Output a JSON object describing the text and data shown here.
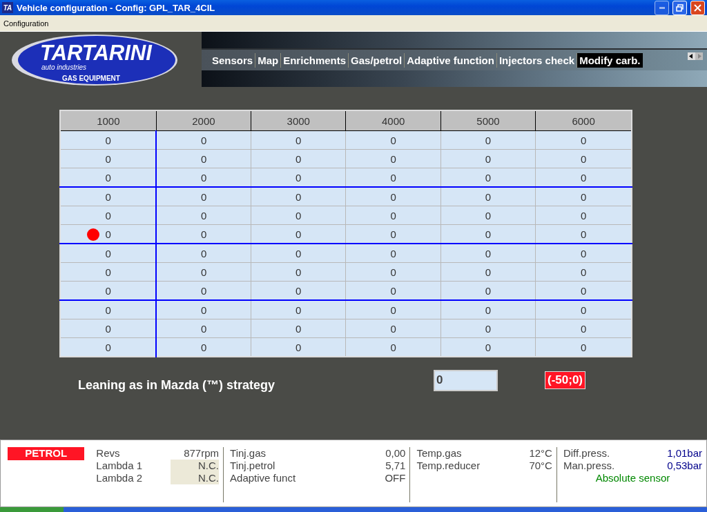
{
  "window": {
    "title": "Vehicle configuration - Config: GPL_TAR_4CIL",
    "icon_text": "TA"
  },
  "menu": [
    "Configuration"
  ],
  "logo": {
    "name": "TARTARINI",
    "subtitle": "auto industries",
    "tagline": "GAS EQUIPMENT"
  },
  "tabs": [
    {
      "label": "Sensors",
      "selected": false
    },
    {
      "label": "Map",
      "selected": false
    },
    {
      "label": "Enrichments",
      "selected": false
    },
    {
      "label": "Gas/petrol",
      "selected": false
    },
    {
      "label": "Adaptive function",
      "selected": false
    },
    {
      "label": "Injectors check",
      "selected": false
    },
    {
      "label": "Modify carb.",
      "selected": true
    }
  ],
  "table": {
    "columns": [
      "1000",
      "2000",
      "3000",
      "4000",
      "5000",
      "6000"
    ],
    "rows": [
      {
        "cells": [
          "0",
          "0",
          "0",
          "0",
          "0",
          "0"
        ],
        "marker": false
      },
      {
        "cells": [
          "0",
          "0",
          "0",
          "0",
          "0",
          "0"
        ],
        "marker": false
      },
      {
        "cells": [
          "0",
          "0",
          "0",
          "0",
          "0",
          "0"
        ],
        "marker": false
      },
      {
        "cells": [
          "0",
          "0",
          "0",
          "0",
          "0",
          "0"
        ],
        "marker": false
      },
      {
        "cells": [
          "0",
          "0",
          "0",
          "0",
          "0",
          "0"
        ],
        "marker": false
      },
      {
        "cells": [
          "0",
          "0",
          "0",
          "0",
          "0",
          "0"
        ],
        "marker": true
      },
      {
        "cells": [
          "0",
          "0",
          "0",
          "0",
          "0",
          "0"
        ],
        "marker": false
      },
      {
        "cells": [
          "0",
          "0",
          "0",
          "0",
          "0",
          "0"
        ],
        "marker": false
      },
      {
        "cells": [
          "0",
          "0",
          "0",
          "0",
          "0",
          "0"
        ],
        "marker": false
      },
      {
        "cells": [
          "0",
          "0",
          "0",
          "0",
          "0",
          "0"
        ],
        "marker": false
      },
      {
        "cells": [
          "0",
          "0",
          "0",
          "0",
          "0",
          "0"
        ],
        "marker": false
      },
      {
        "cells": [
          "0",
          "0",
          "0",
          "0",
          "0",
          "0"
        ],
        "marker": false
      }
    ]
  },
  "leaning": {
    "label": "Leaning as in Mazda (™) strategy",
    "value": "0",
    "range": "(-50;0)"
  },
  "status_bar": {
    "mode": "PETROL",
    "groups": [
      [
        {
          "label": "Revs",
          "value": "877rpm",
          "shaded": false
        },
        {
          "label": "Lambda 1",
          "value": "N.C.",
          "shaded": true
        },
        {
          "label": "Lambda 2",
          "value": "N.C.",
          "shaded": true
        }
      ],
      [
        {
          "label": "Tinj.gas",
          "value": "0,00",
          "shaded": false
        },
        {
          "label": "Tinj.petrol",
          "value": "5,71",
          "shaded": false
        },
        {
          "label": "Adaptive funct",
          "value": "OFF",
          "shaded": false
        }
      ],
      [
        {
          "label": "Temp.gas",
          "value": "12°C",
          "shaded": false
        },
        {
          "label": "Temp.reducer",
          "value": "70°C",
          "shaded": false
        }
      ],
      [
        {
          "label": "Diff.press.",
          "value": "1,01bar",
          "shaded": false
        },
        {
          "label": "Man.press.",
          "value": "0,53bar",
          "shaded": false
        }
      ]
    ],
    "sensor_note": "Absolute sensor"
  }
}
